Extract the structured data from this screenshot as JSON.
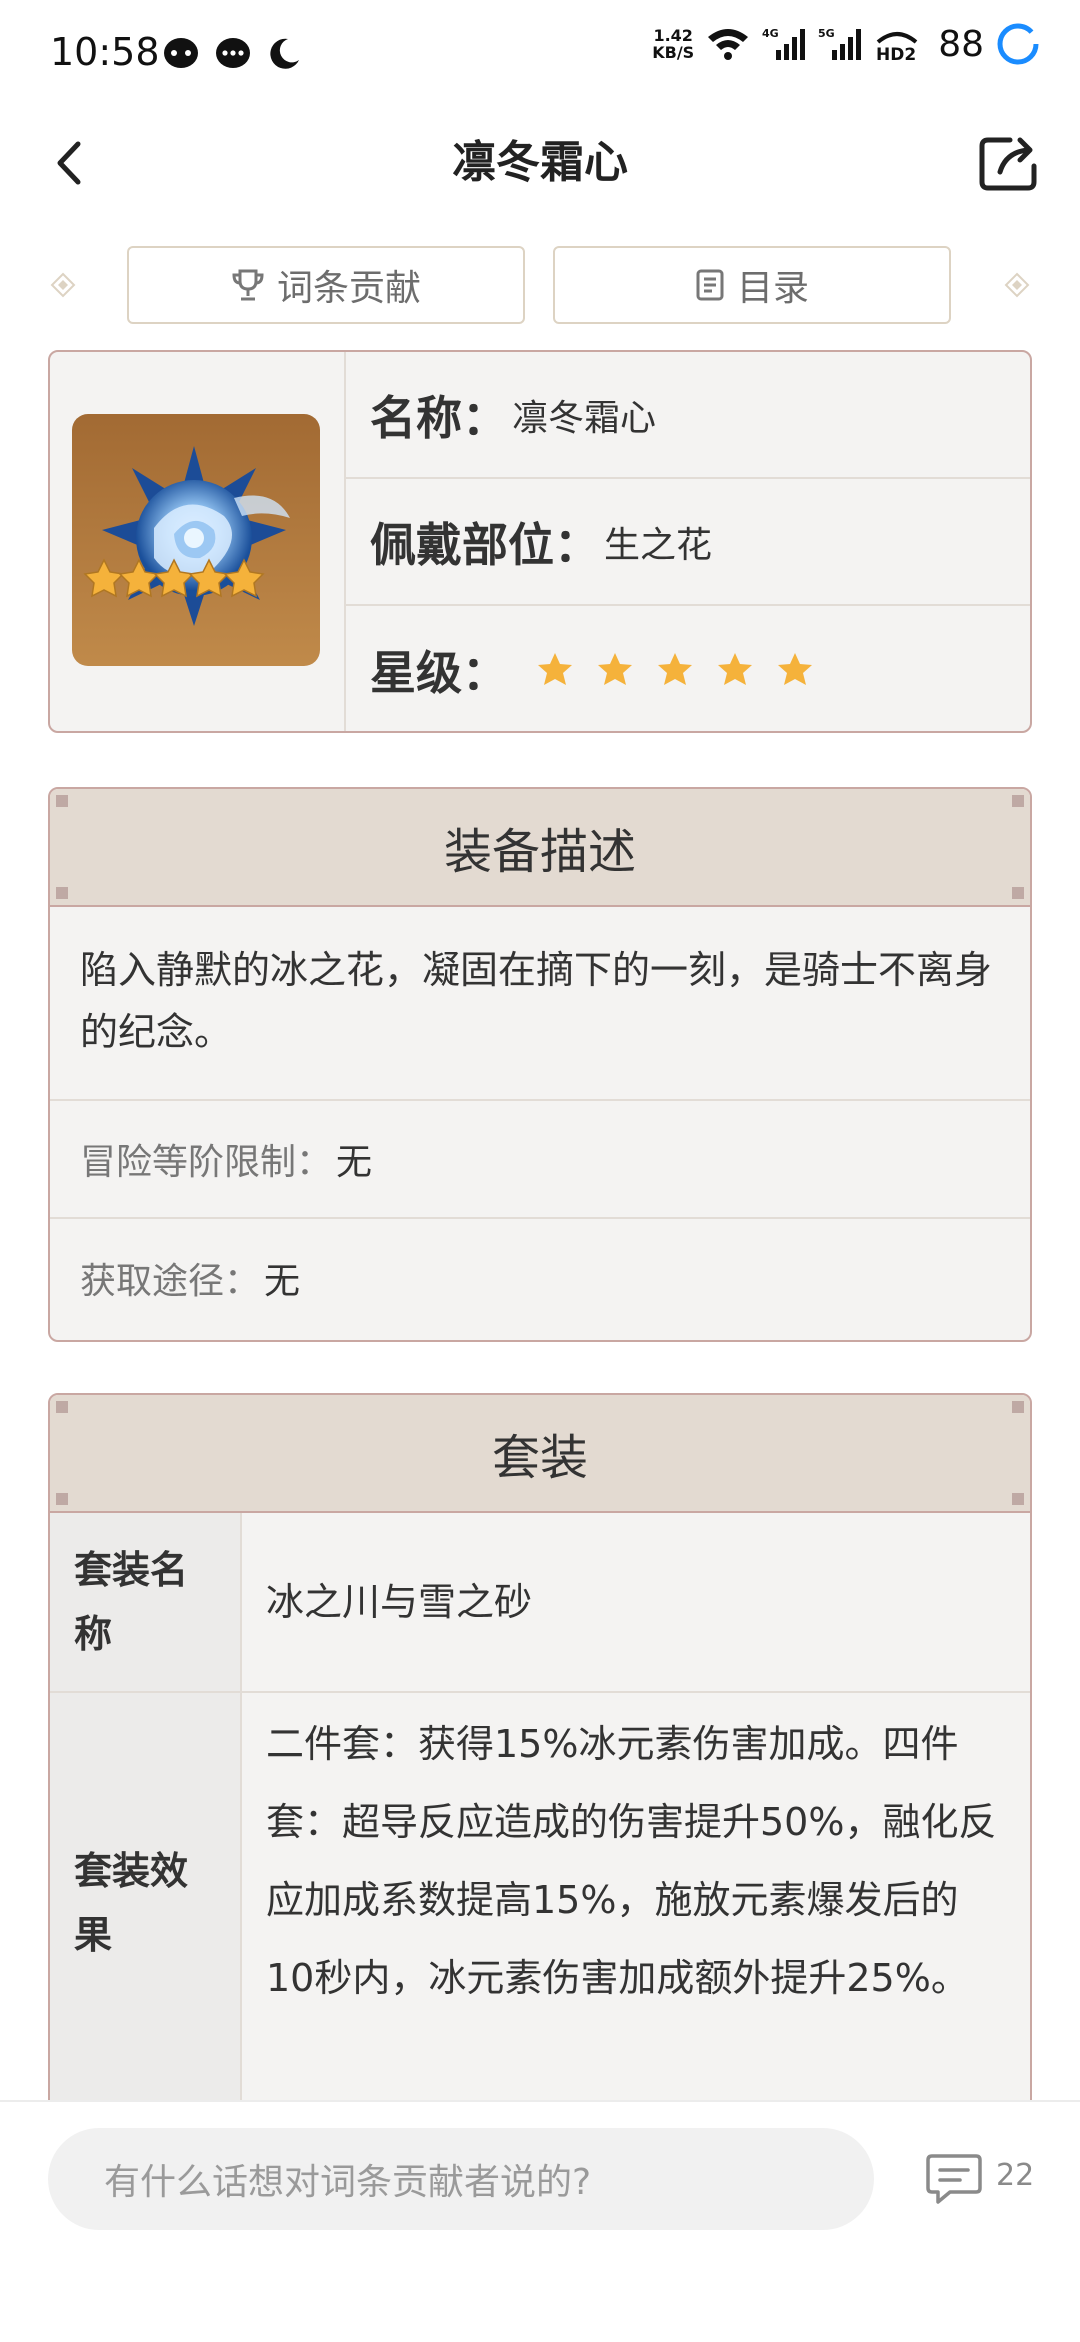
{
  "status": {
    "time": "10:58",
    "net_speed_top": "1.42",
    "net_speed_bottom": "KB/S",
    "battery": "88"
  },
  "header": {
    "title": "凛冬霜心"
  },
  "tabs": {
    "contribute": "词条贡献",
    "catalog": "目录"
  },
  "info": {
    "name_label": "名称：",
    "name_value": "凛冬霜心",
    "slot_label": "佩戴部位：",
    "slot_value": "生之花",
    "rarity_label": "星级：",
    "rarity_stars": 5,
    "star_color": "#f5b23b"
  },
  "description": {
    "title": "装备描述",
    "text": "陷入静默的冰之花，凝固在摘下的一刻，是骑士不离身的纪念。",
    "rank_label": "冒险等阶限制：",
    "rank_value": "无",
    "source_label": "获取途径：",
    "source_value": "无"
  },
  "set": {
    "title": "套装",
    "name_key": "套装名称",
    "name_value": "冰之川与雪之砂",
    "effect_key": "套装效果",
    "effect_value": "二件套：获得15%冰元素伤害加成。四件套：超导反应造成的伤害提升50%，融化反应加成系数提高15%，施放元素爆发后的10秒内，冰元素伤害加成额外提升25%。"
  },
  "comment": {
    "placeholder": "有什么话想对词条贡献者说的?",
    "count": "22"
  }
}
